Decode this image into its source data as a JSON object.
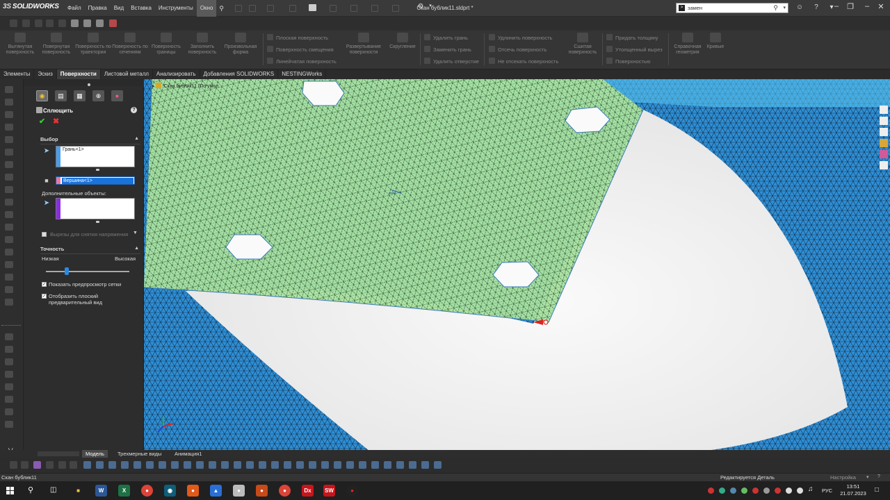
{
  "app": {
    "logo_prefix": "3S",
    "logo_name": "SOLIDWORKS",
    "document_title": "Скан бублик11.sldprt *"
  },
  "menu": [
    "Файл",
    "Правка",
    "Вид",
    "Вставка",
    "Инструменты",
    "Окно"
  ],
  "search": {
    "prefix": ">",
    "value": "замен"
  },
  "ribbon": {
    "large_buttons": [
      "Вытянутая поверхность",
      "Повернутая поверхность",
      "Поверхность по траектории",
      "Поверхность по сечениям",
      "Поверхность границы",
      "Заполнить поверхность",
      "Произвольная форма"
    ],
    "col1": [
      "Плоская поверхность",
      "Поверхность смещения",
      "Линейчатая поверхность"
    ],
    "mid_buttons": [
      "Развертывание поверхности",
      "Скругление"
    ],
    "col2": [
      "Удалить грань",
      "Заменить грань",
      "Удалить отверстие"
    ],
    "col3": [
      "Удлинить поверхность",
      "Отсечь поверхность",
      "Не отсекать поверхность"
    ],
    "knit": "Сшитая поверхность",
    "col4": [
      "Придать толщину",
      "Утолщенный вырез",
      "Поверхностью"
    ],
    "right_buttons": [
      "Справочная геометрия",
      "Кривые"
    ]
  },
  "tabs": [
    "Элементы",
    "Эскиз",
    "Поверхности",
    "Листовой металл",
    "Анализировать",
    "Добавления SOLIDWORKS",
    "NESTINGWorks"
  ],
  "active_tab_index": 2,
  "property_manager": {
    "title": "Сплющить",
    "selection_group": "Выбор",
    "face_value": "Грань<1>",
    "vertex_value": "Вершина<1>",
    "additional_label": "Дополнительные объекты:",
    "relief_label": "Вырезы для снятия напряжения",
    "accuracy_group": "Точность",
    "low_label": "Низкая",
    "high_label": "Высокая",
    "accuracy_level": 0.25,
    "show_mesh_label": "Показать предпросмотр сетки",
    "show_mesh_checked": true,
    "flat_preview_line1": "Отобразить плоский",
    "flat_preview_line2": "предварительный вид",
    "flat_preview_checked": true
  },
  "viewport": {
    "tree_flyout": "Скан бублик11 (По умол"
  },
  "bottom_tabs": [
    "Модель",
    "Трехмерные виды",
    "Анимация1"
  ],
  "active_bottom_tab": 0,
  "status": {
    "left": "Скан бублик11",
    "middle": "Редактируется Деталь",
    "right": "Настройка"
  },
  "taskbar": {
    "language": "РУС",
    "time": "13:51",
    "date": "21.07.2023"
  },
  "colors": {
    "mesh_blue": "#2e8fd6",
    "preview_green": "#a9e2a1",
    "accent_blue": "#1a73d9",
    "vertex_pink": "#e8789c",
    "additional_purple": "#8a2be2"
  }
}
